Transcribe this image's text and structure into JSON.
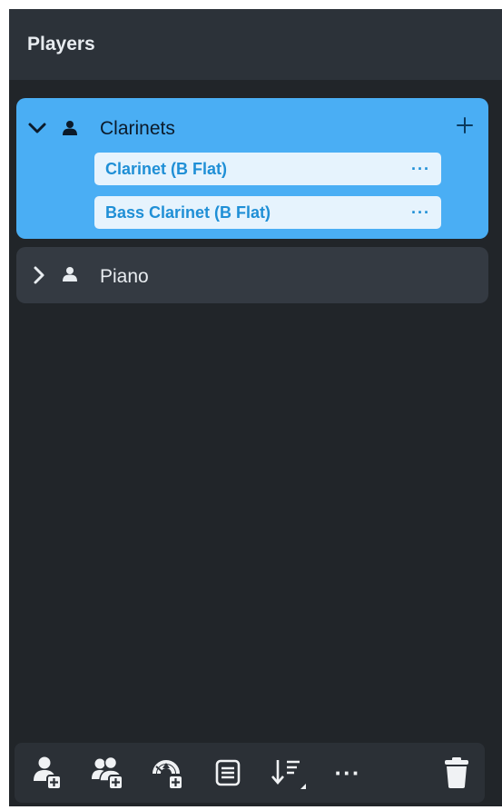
{
  "panel": {
    "title": "Players"
  },
  "players": [
    {
      "name": "Clarinets",
      "expanded": true,
      "instruments": [
        {
          "name": "Clarinet (B Flat)",
          "more_label": "···"
        },
        {
          "name": "Bass Clarinet (B Flat)",
          "more_label": "···"
        }
      ]
    },
    {
      "name": "Piano",
      "expanded": false,
      "instruments": []
    }
  ],
  "toolbar": {
    "items": [
      {
        "icon": "add-solo-player-icon"
      },
      {
        "icon": "add-section-player-icon"
      },
      {
        "icon": "add-ensemble-icon"
      },
      {
        "icon": "list-icon"
      },
      {
        "icon": "sort-icon"
      },
      {
        "icon": "more-icon",
        "label": "···"
      },
      {
        "icon": "trash-icon"
      }
    ]
  },
  "colors": {
    "panel_bg": "#212529",
    "header_bg": "#2c3239",
    "selected_card": "#4aaef4",
    "card": "#343a42",
    "instrument_bg": "#e6f3fd",
    "instrument_text": "#1f8fd6"
  }
}
